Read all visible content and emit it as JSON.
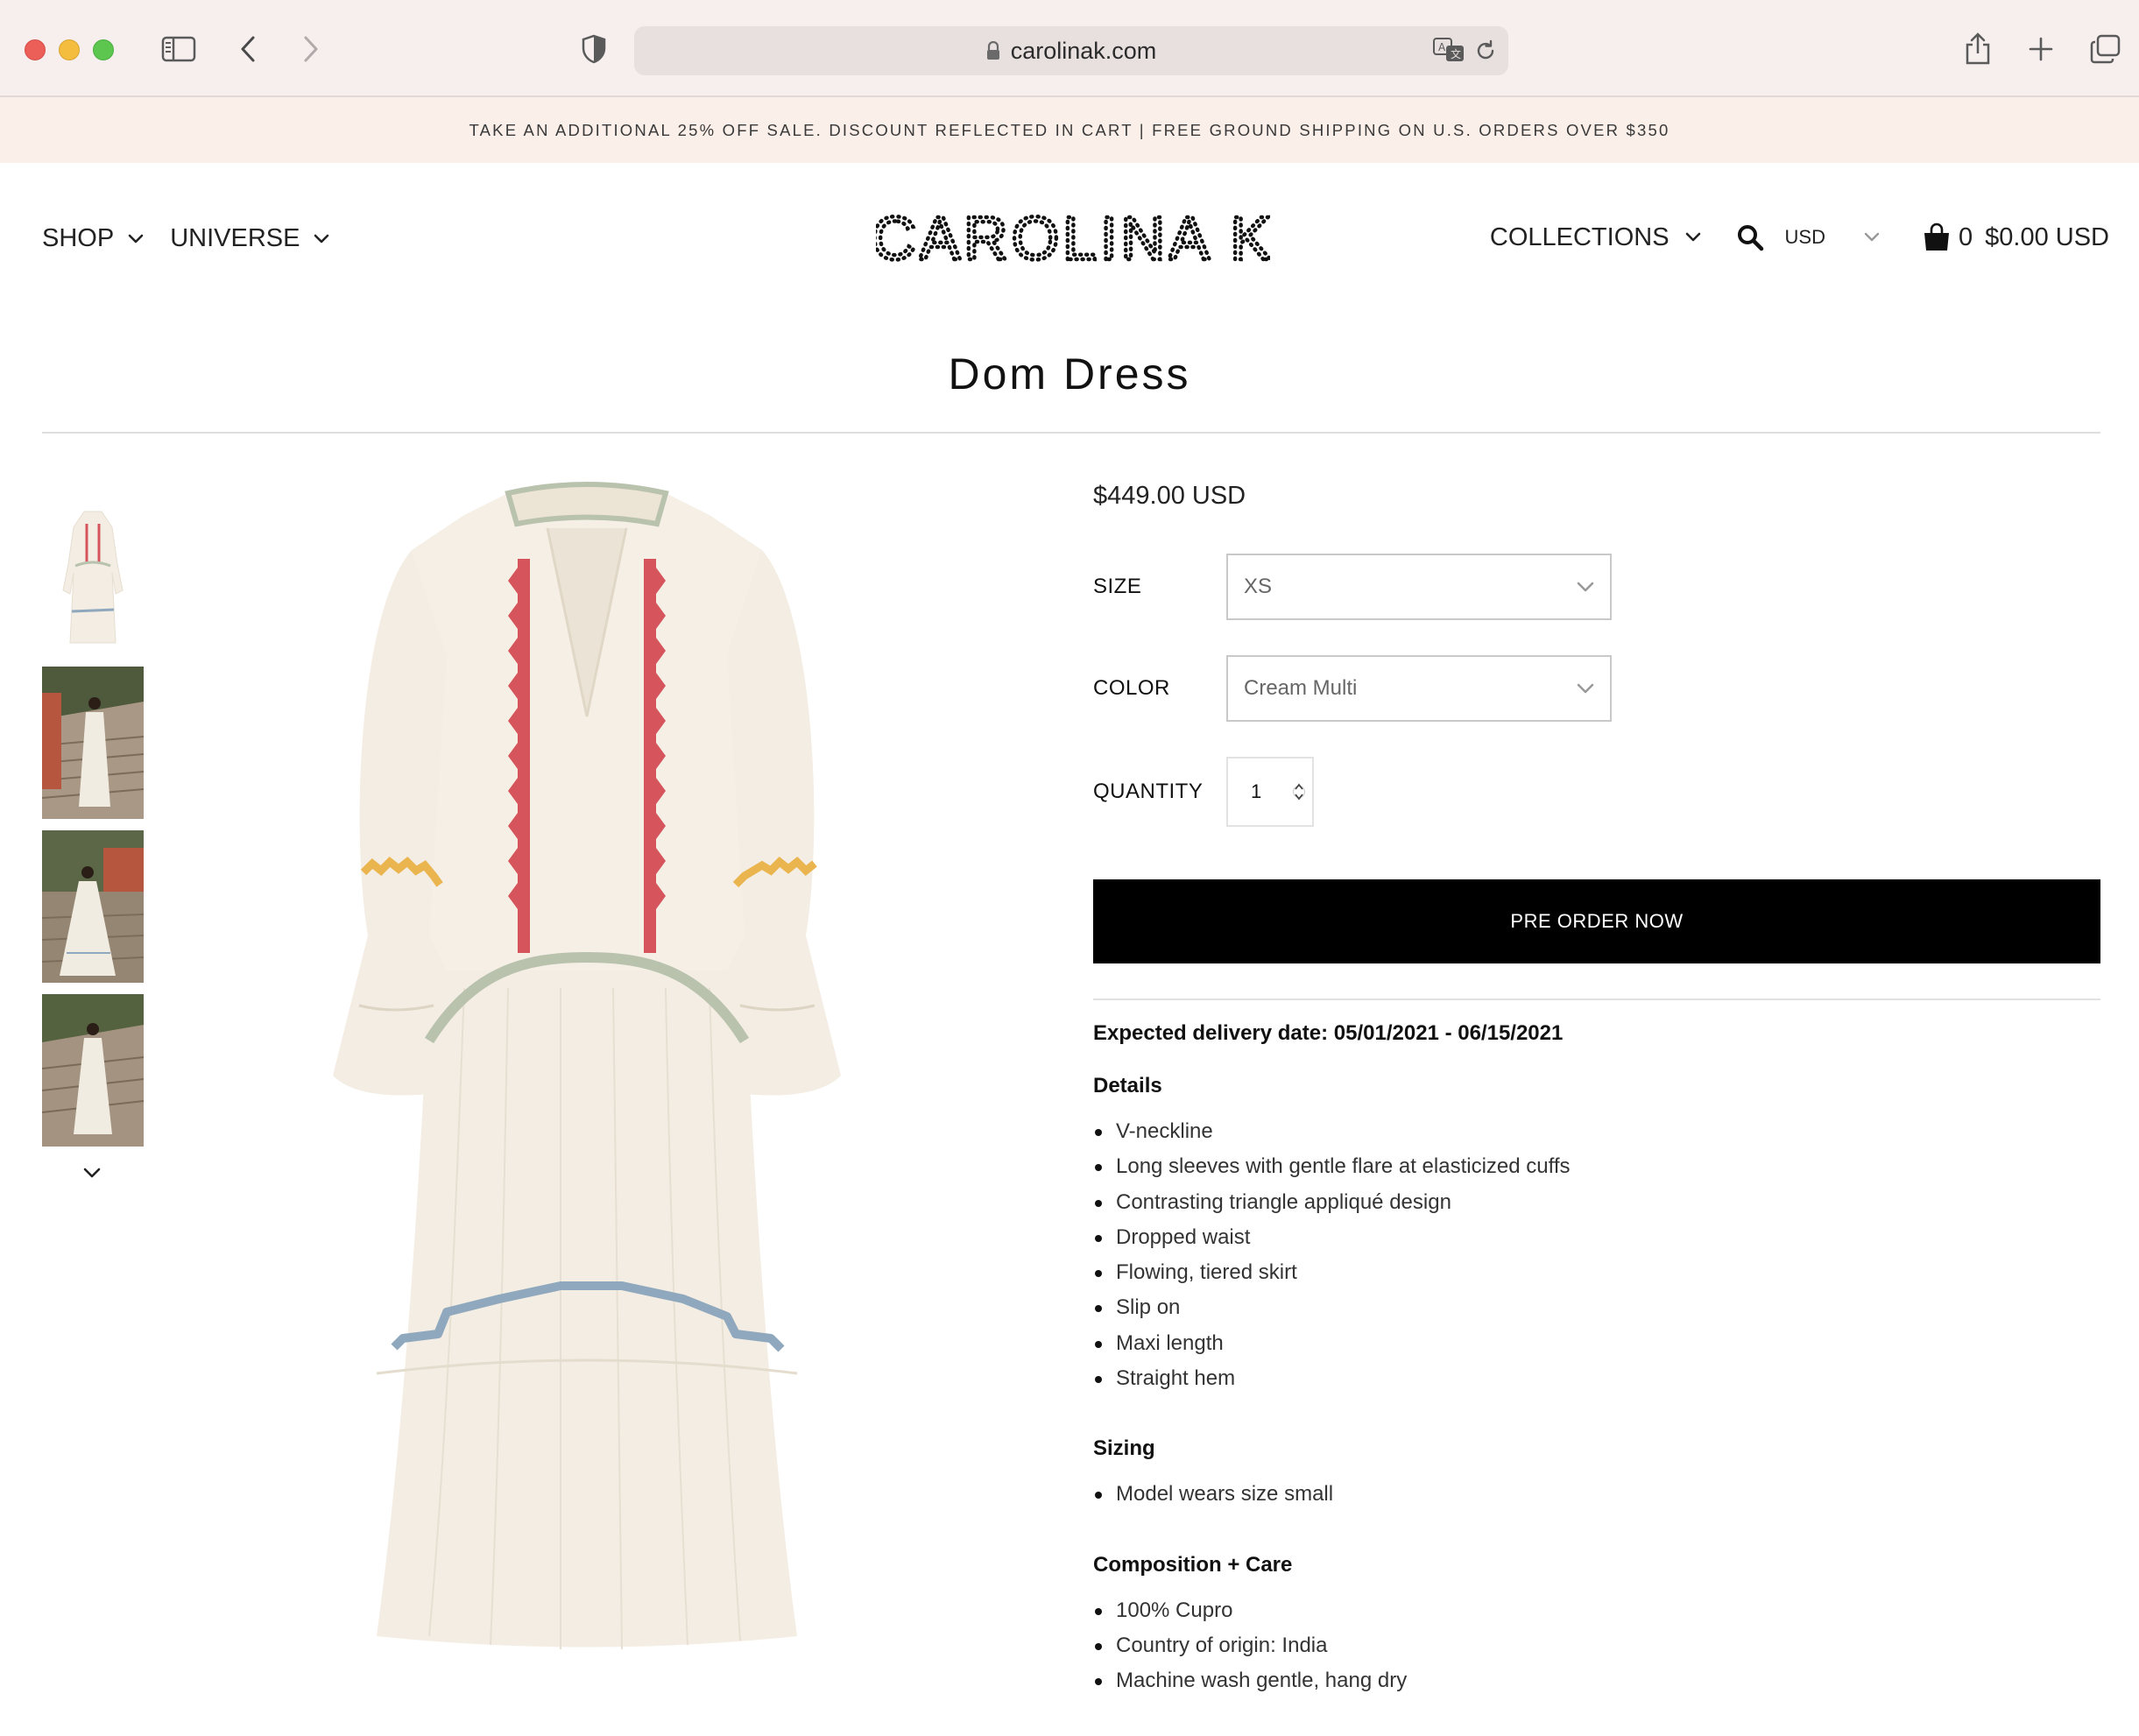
{
  "browser": {
    "url": "carolinak.com"
  },
  "promo": {
    "text": "TAKE AN ADDITIONAL 25% OFF SALE. DISCOUNT REFLECTED IN CART | FREE GROUND SHIPPING ON U.S. ORDERS OVER $350"
  },
  "header": {
    "nav_left": [
      {
        "label": "SHOP"
      },
      {
        "label": "UNIVERSE"
      }
    ],
    "logo_text": "CAROLINA K",
    "collections_label": "COLLECTIONS",
    "currency": "USD",
    "cart_count": "0",
    "cart_total": "$0.00 USD"
  },
  "product": {
    "title": "Dom Dress",
    "price": "$449.00 USD",
    "size_label": "SIZE",
    "size_value": "XS",
    "color_label": "COLOR",
    "color_value": "Cream Multi",
    "quantity_label": "QUANTITY",
    "quantity_value": "1",
    "cta": "PRE ORDER NOW",
    "delivery": "Expected delivery date: 05/01/2021 - 06/15/2021",
    "details_heading": "Details",
    "details": [
      "V-neckline",
      "Long sleeves with gentle flare at elasticized cuffs",
      "Contrasting triangle appliqué design",
      "Dropped waist",
      "Flowing, tiered skirt",
      "Slip on",
      "Maxi length",
      "Straight hem"
    ],
    "sizing_heading": "Sizing",
    "sizing": [
      "Model wears size small"
    ],
    "care_heading": "Composition + Care",
    "care": [
      "100% Cupro",
      "Country of origin: India",
      "Machine wash gentle, hang dry"
    ]
  },
  "colors": {
    "promo_bg": "#fbefe9",
    "cta_bg": "#000000",
    "dress": "#f3ede3",
    "trim_red": "#d6555c",
    "trim_sage": "#b9c2ad",
    "trim_blue": "#8fa8bd",
    "trim_yellow": "#eab54e"
  },
  "icons": [
    "sidebar-icon",
    "back-chevron-icon",
    "forward-chevron-icon",
    "shield-icon",
    "lock-icon",
    "translate-icon",
    "reload-icon",
    "share-icon",
    "new-tab-icon",
    "tab-overview-icon",
    "search-icon",
    "cart-bag-icon",
    "chevron-down-icon"
  ]
}
